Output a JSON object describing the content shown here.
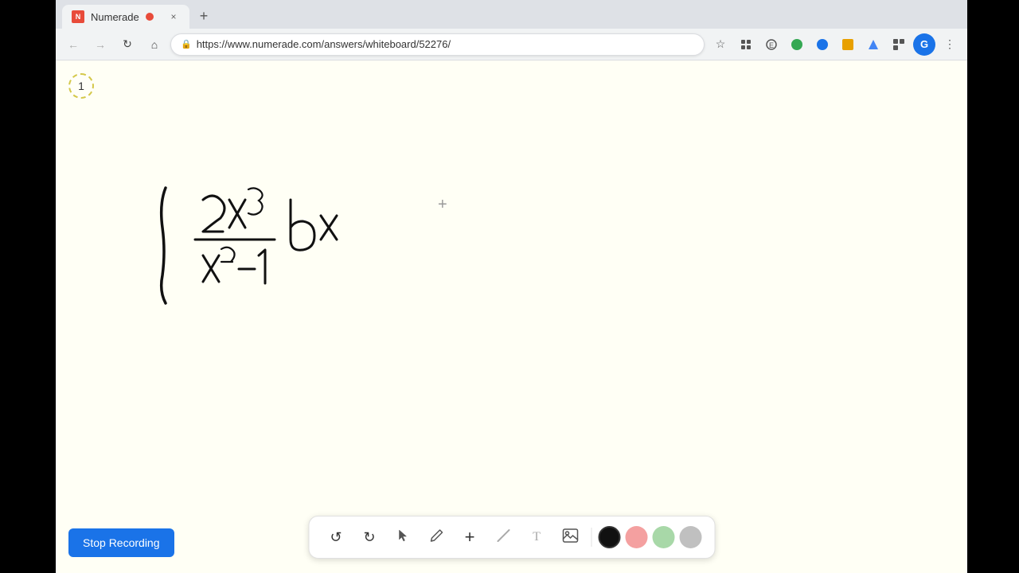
{
  "browser": {
    "tab": {
      "title": "Numerade",
      "favicon_color": "#e84b3a",
      "recording_dot": true
    },
    "url": "https://www.numerade.com/answers/whiteboard/52276/",
    "nav": {
      "back": "←",
      "forward": "→",
      "refresh": "↻",
      "home": "⌂"
    }
  },
  "whiteboard": {
    "page_number": "1",
    "math_formula": "∫ (2x³)/(x²−1) dx"
  },
  "toolbar": {
    "undo_label": "↺",
    "redo_label": "↻",
    "select_label": "▶",
    "pen_label": "✏",
    "add_label": "+",
    "line_label": "/",
    "text_label": "T",
    "image_label": "🖼",
    "colors": [
      "#111111",
      "#f4a0a0",
      "#a8d8a8",
      "#c0c0c0"
    ]
  },
  "stop_recording": {
    "label": "Stop Recording"
  },
  "icons": {
    "undo": "↺",
    "redo": "↻",
    "cursor": "▶",
    "pen": "✏",
    "plus": "+",
    "line": "/",
    "text": "T",
    "image": "⬜",
    "bookmark": "☆",
    "extensions": "⚡",
    "menu": "⋮",
    "lock": "🔒"
  }
}
